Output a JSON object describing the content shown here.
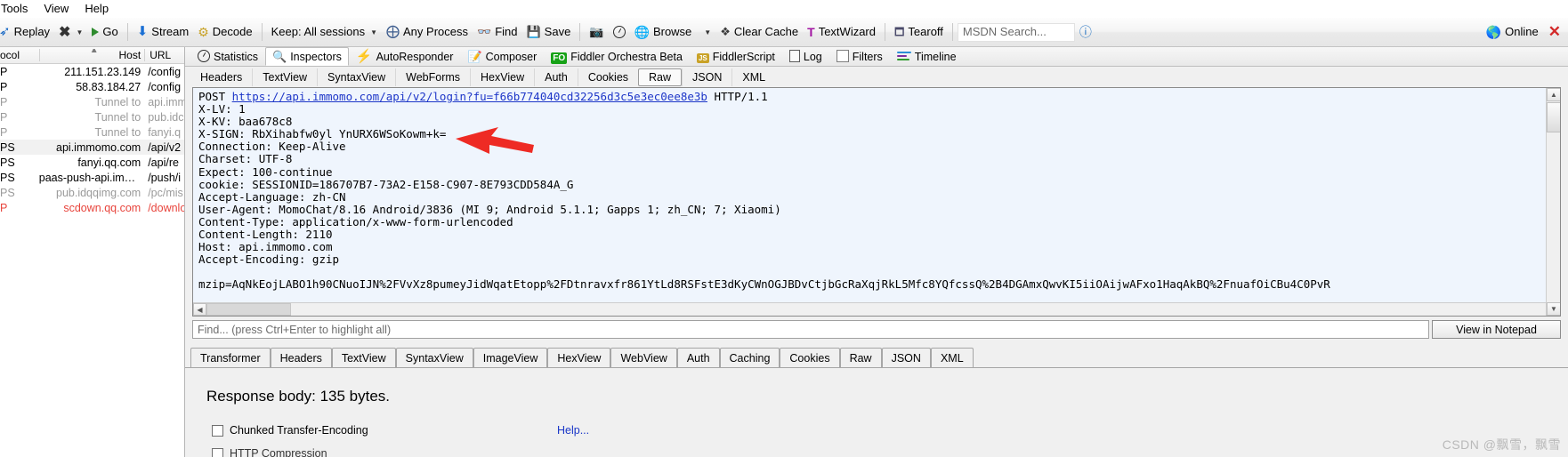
{
  "menu": {
    "items": [
      {
        "label": "Tools"
      },
      {
        "label": "View"
      },
      {
        "label": "Help"
      }
    ]
  },
  "toolbar": {
    "replay": "Replay",
    "remove": "",
    "go": "Go",
    "stream": "Stream",
    "decode": "Decode",
    "keep": "Keep: All sessions",
    "any_process": "Any Process",
    "find": "Find",
    "save": "Save",
    "browse": "Browse",
    "clear_cache": "Clear Cache",
    "text_wizard": "TextWizard",
    "tearoff": "Tearoff",
    "msdn_search": "MSDN Search...",
    "online": "Online",
    "close": "✕"
  },
  "sessions": {
    "columns": {
      "protocol": "ocol",
      "host": "Host",
      "url": "URL"
    },
    "rows": [
      {
        "protocol": "P",
        "host": "211.151.23.149",
        "url": "/config",
        "style": "normal"
      },
      {
        "protocol": "P",
        "host": "58.83.184.27",
        "url": "/config",
        "style": "normal"
      },
      {
        "protocol": "P",
        "host": "Tunnel to",
        "url": "api.imm",
        "style": "gray"
      },
      {
        "protocol": "P",
        "host": "Tunnel to",
        "url": "pub.idc",
        "style": "gray"
      },
      {
        "protocol": "P",
        "host": "Tunnel to",
        "url": "fanyi.q",
        "style": "gray"
      },
      {
        "protocol": "PS",
        "host": "api.immomo.com",
        "url": "/api/v2",
        "style": "selected"
      },
      {
        "protocol": "PS",
        "host": "fanyi.qq.com",
        "url": "/api/re",
        "style": "normal"
      },
      {
        "protocol": "PS",
        "host": "paas-push-api.immo…",
        "url": "/push/i",
        "style": "normal"
      },
      {
        "protocol": "PS",
        "host": "pub.idqqimg.com",
        "url": "/pc/mis",
        "style": "gray"
      },
      {
        "protocol": "P",
        "host": "scdown.qq.com",
        "url": "/downlo",
        "style": "red"
      }
    ]
  },
  "inspector_tabs": [
    {
      "label": "Statistics",
      "icon": "clock-icon",
      "active": false
    },
    {
      "label": "Inspectors",
      "icon": "magnifier-icon",
      "active": true
    },
    {
      "label": "AutoResponder",
      "icon": "bolt-icon",
      "active": false
    },
    {
      "label": "Composer",
      "icon": "pencil-pad-icon",
      "active": false
    },
    {
      "label": "Fiddler Orchestra Beta",
      "icon": "fo-icon",
      "active": false
    },
    {
      "label": "FiddlerScript",
      "icon": "js-icon",
      "active": false
    },
    {
      "label": "Log",
      "icon": "log-icon",
      "active": false
    },
    {
      "label": "Filters",
      "icon": "filter-box-icon",
      "active": false
    },
    {
      "label": "Timeline",
      "icon": "timeline-icon",
      "active": false
    }
  ],
  "request_tabs": [
    {
      "label": "Headers",
      "active": false
    },
    {
      "label": "TextView",
      "active": false
    },
    {
      "label": "SyntaxView",
      "active": false
    },
    {
      "label": "WebForms",
      "active": false
    },
    {
      "label": "HexView",
      "active": false
    },
    {
      "label": "Auth",
      "active": false
    },
    {
      "label": "Cookies",
      "active": false
    },
    {
      "label": "Raw",
      "active": true
    },
    {
      "label": "JSON",
      "active": false
    },
    {
      "label": "XML",
      "active": false
    }
  ],
  "request_raw": {
    "method": "POST",
    "url": "https://api.immomo.com/api/v2/login?fu=f66b774040cd32256d3c5e3ec0ee8e3b",
    "version": "HTTP/1.1",
    "headers": [
      "X-LV: 1",
      "X-KV: baa678c8",
      "X-SIGN: RbXihabfw0yl YnURX6WSoKowm+k=",
      "Connection: Keep-Alive",
      "Charset: UTF-8",
      "Expect: 100-continue",
      "cookie: SESSIONID=186707B7-73A2-E158-C907-8E793CDD584A_G",
      "Accept-Language: zh-CN",
      "User-Agent: MomoChat/8.16 Android/3836 (MI 9; Android 5.1.1; Gapps 1; zh_CN; 7; Xiaomi)",
      "Content-Type: application/x-www-form-urlencoded",
      "Content-Length: 2110",
      "Host: api.immomo.com",
      "Accept-Encoding: gzip"
    ],
    "body": "mzip=AqNkEojLABO1h90CNuoIJN%2FVvXz8pumeyJidWqatEtopp%2FDtnravxfr861YtLd8RSFstE3dKyCWnOGJBDvCtjbGcRaXqjRkL5Mfc8YQfcssQ%2B4DGAmxQwvKI5iiOAijwAFxo1HaqAkBQ%2FnuafOiCBu4C0PvR"
  },
  "findbar": {
    "placeholder": "Find... (press Ctrl+Enter to highlight all)",
    "view_in_notepad": "View in Notepad"
  },
  "response_tabs": [
    {
      "label": "Transformer",
      "active": false
    },
    {
      "label": "Headers",
      "active": false
    },
    {
      "label": "TextView",
      "active": false
    },
    {
      "label": "SyntaxView",
      "active": false
    },
    {
      "label": "ImageView",
      "active": false
    },
    {
      "label": "HexView",
      "active": false
    },
    {
      "label": "WebView",
      "active": false
    },
    {
      "label": "Auth",
      "active": false
    },
    {
      "label": "Caching",
      "active": false
    },
    {
      "label": "Cookies",
      "active": false
    },
    {
      "label": "Raw",
      "active": false
    },
    {
      "label": "JSON",
      "active": false
    },
    {
      "label": "XML",
      "active": false
    }
  ],
  "response_body": {
    "title": "Response body: 135 bytes.",
    "chunked_label": "Chunked Transfer-Encoding",
    "help_label": "Help...",
    "http_compression_label": "HTTP Compression"
  },
  "watermark": "CSDN @飘雪，飘雪",
  "colors": {
    "link": "#1d36c8",
    "annotation_arrow": "#ee2b24",
    "selected_row": "#f1f1f1",
    "red_session": "#e8443c",
    "editor_bg": "#eff5fd"
  }
}
